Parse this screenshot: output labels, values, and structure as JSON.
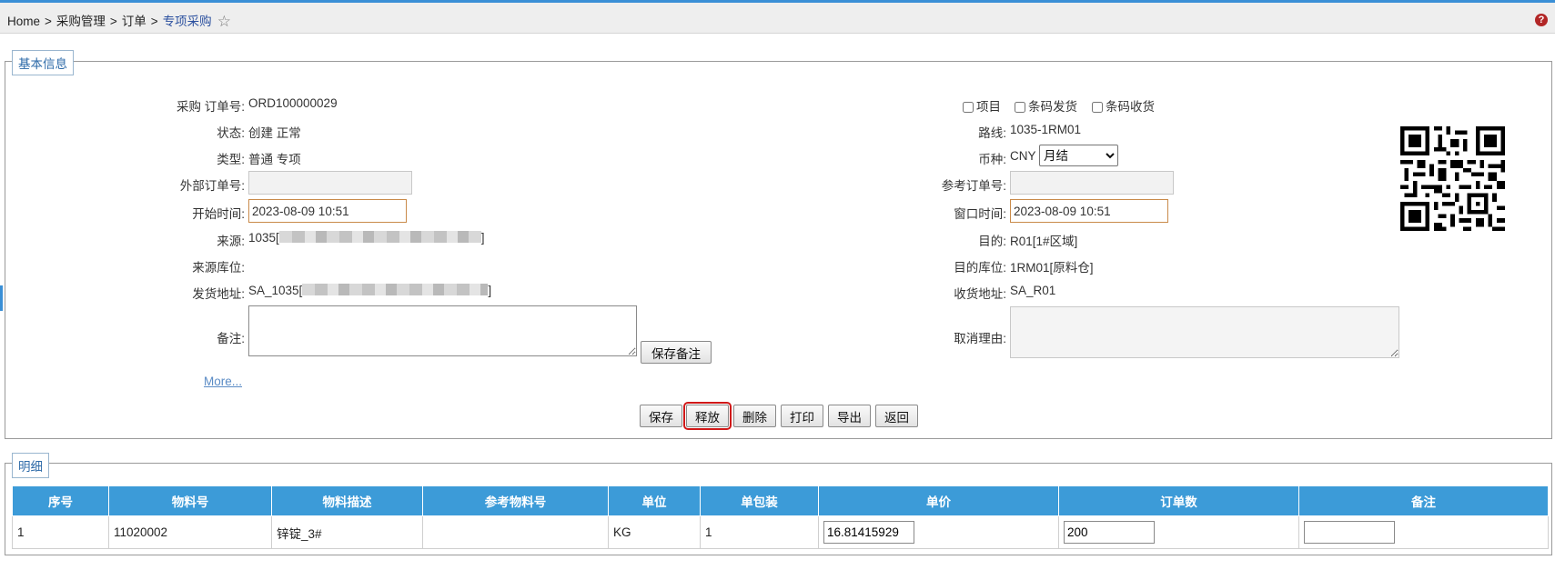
{
  "breadcrumb": {
    "items": [
      "Home",
      "采购管理",
      "订单"
    ],
    "current": "专项采购",
    "separator": ">"
  },
  "colors": {
    "accent": "#3a8fd6",
    "table_header": "#3c9bd8",
    "highlight": "#d01818"
  },
  "basic_info": {
    "legend": "基本信息",
    "left": {
      "order_no_label": "采购 订单号:",
      "order_no": "ORD100000029",
      "status_label": "状态:",
      "status": "创建 正常",
      "type_label": "类型:",
      "type": "普通 专项",
      "ext_order_label": "外部订单号:",
      "ext_order": "",
      "start_time_label": "开始时间:",
      "start_time": "2023-08-09 10:51",
      "source_label": "来源:",
      "source_prefix": "1035[",
      "source_suffix": "]",
      "source_loc_label": "来源库位:",
      "ship_addr_label": "发货地址:",
      "ship_addr_prefix": "SA_1035[",
      "ship_addr_suffix": "]",
      "remark_label": "备注:",
      "save_remark": "保存备注",
      "more_link": "More..."
    },
    "right": {
      "chk_project": "项目",
      "chk_barcode_ship": "条码发货",
      "chk_barcode_receive": "条码收货",
      "route_label": "路线:",
      "route": "1035-1RM01",
      "currency_label": "币种:",
      "currency": "CNY",
      "settlement_selected": "月结",
      "ref_order_label": "参考订单号:",
      "ref_order": "",
      "window_time_label": "窗口时间:",
      "window_time": "2023-08-09 10:51",
      "dest_label": "目的:",
      "dest": "R01[1#区域]",
      "dest_loc_label": "目的库位:",
      "dest_loc": "1RM01[原料仓]",
      "recv_addr_label": "收货地址:",
      "recv_addr": "SA_R01",
      "cancel_reason_label": "取消理由:"
    },
    "actions": {
      "save": "保存",
      "release": "释放",
      "delete": "删除",
      "print": "打印",
      "export": "导出",
      "back": "返回"
    }
  },
  "detail": {
    "legend": "明细",
    "columns": [
      "序号",
      "物料号",
      "物料描述",
      "参考物料号",
      "单位",
      "单包装",
      "单价",
      "订单数",
      "备注"
    ],
    "rows": [
      {
        "seq": "1",
        "material_no": "11020002",
        "material_desc": "锌锭_3#",
        "ref_material": "",
        "unit": "KG",
        "pack": "1",
        "price": "16.81415929",
        "qty": "200",
        "remark": ""
      }
    ]
  }
}
